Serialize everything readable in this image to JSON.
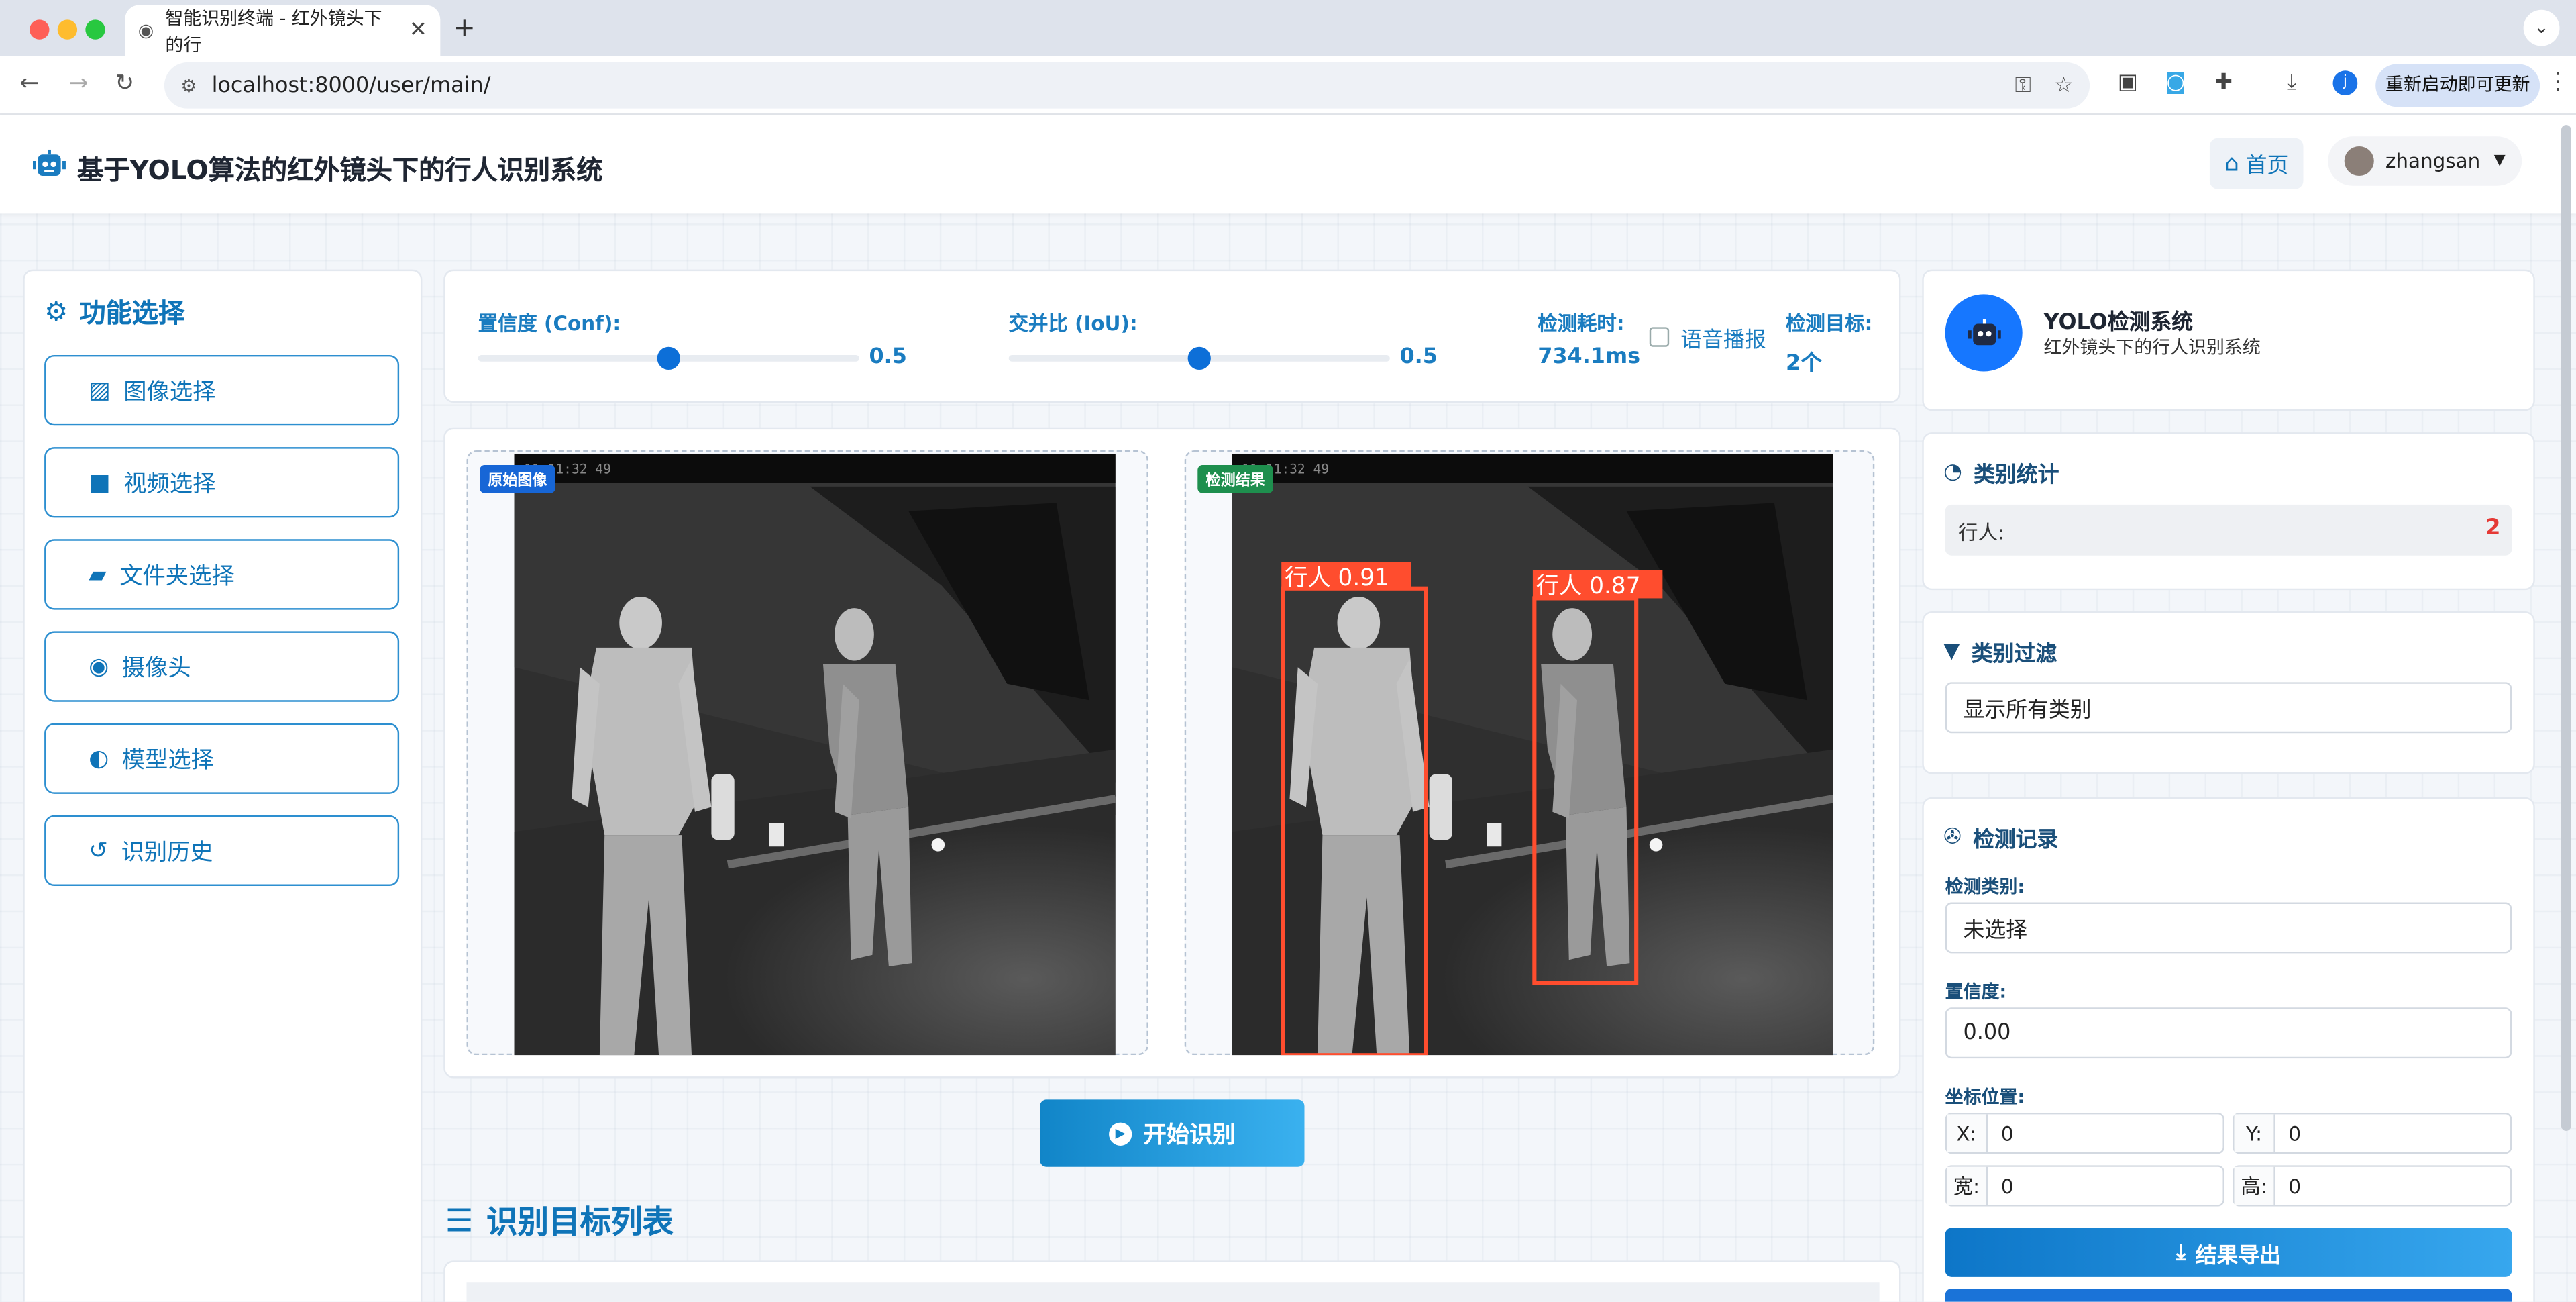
{
  "browser": {
    "tab_title": "智能识别终端 - 红外镜头下的行",
    "url": "localhost:8000/user/main/",
    "relaunch_label": "重新启动即可更新",
    "profile_initial": "j"
  },
  "header": {
    "title": "基于YOLO算法的红外镜头下的行人识别系统",
    "home_label": "首页",
    "username": "zhangsan"
  },
  "menu": {
    "title": "功能选择",
    "items": [
      {
        "label": "图像选择",
        "icon": "image-icon"
      },
      {
        "label": "视频选择",
        "icon": "video-icon"
      },
      {
        "label": "文件夹选择",
        "icon": "folder-icon"
      },
      {
        "label": "摄像头",
        "icon": "camera-icon"
      },
      {
        "label": "模型选择",
        "icon": "brain-icon"
      },
      {
        "label": "识别历史",
        "icon": "history-icon"
      }
    ]
  },
  "controls": {
    "conf_label": "置信度 (Conf):",
    "conf_value": "0.5",
    "conf": 0.5,
    "iou_label": "交并比 (IoU):",
    "iou_value": "0.5",
    "iou": 0.5,
    "time_label": "检测耗时:",
    "time_value": "734.1ms",
    "voice_label": "语音播报",
    "target_label": "检测目标:",
    "target_value": "2个"
  },
  "images": {
    "original_badge": "原始图像",
    "result_badge": "检测结果",
    "timestamp": "11:11:32 49",
    "detections": [
      {
        "label": "行人 0.91"
      },
      {
        "label": "行人 0.87"
      }
    ]
  },
  "start_label": "开始识别",
  "list_title": "识别目标列表",
  "system": {
    "name": "YOLO检测系统",
    "subtitle": "红外镜头下的行人识别系统"
  },
  "stats": {
    "title": "类别统计",
    "rows": [
      {
        "label": "行人:",
        "count": "2"
      }
    ]
  },
  "filter": {
    "title": "类别过滤",
    "selected": "显示所有类别"
  },
  "record": {
    "title": "检测记录",
    "class_label": "检测类别:",
    "class_value": "未选择",
    "conf_label": "置信度:",
    "conf_value": "0.00",
    "coord_label": "坐标位置:",
    "x_label": "X:",
    "x_value": "0",
    "y_label": "Y:",
    "y_value": "0",
    "w_label": "宽:",
    "w_value": "0",
    "h_label": "高:",
    "h_value": "0",
    "export_label": "结果导出"
  },
  "colors": {
    "accent": "#0f74b8",
    "detection_box": "#ff4d2e",
    "count_red": "#e53935"
  }
}
